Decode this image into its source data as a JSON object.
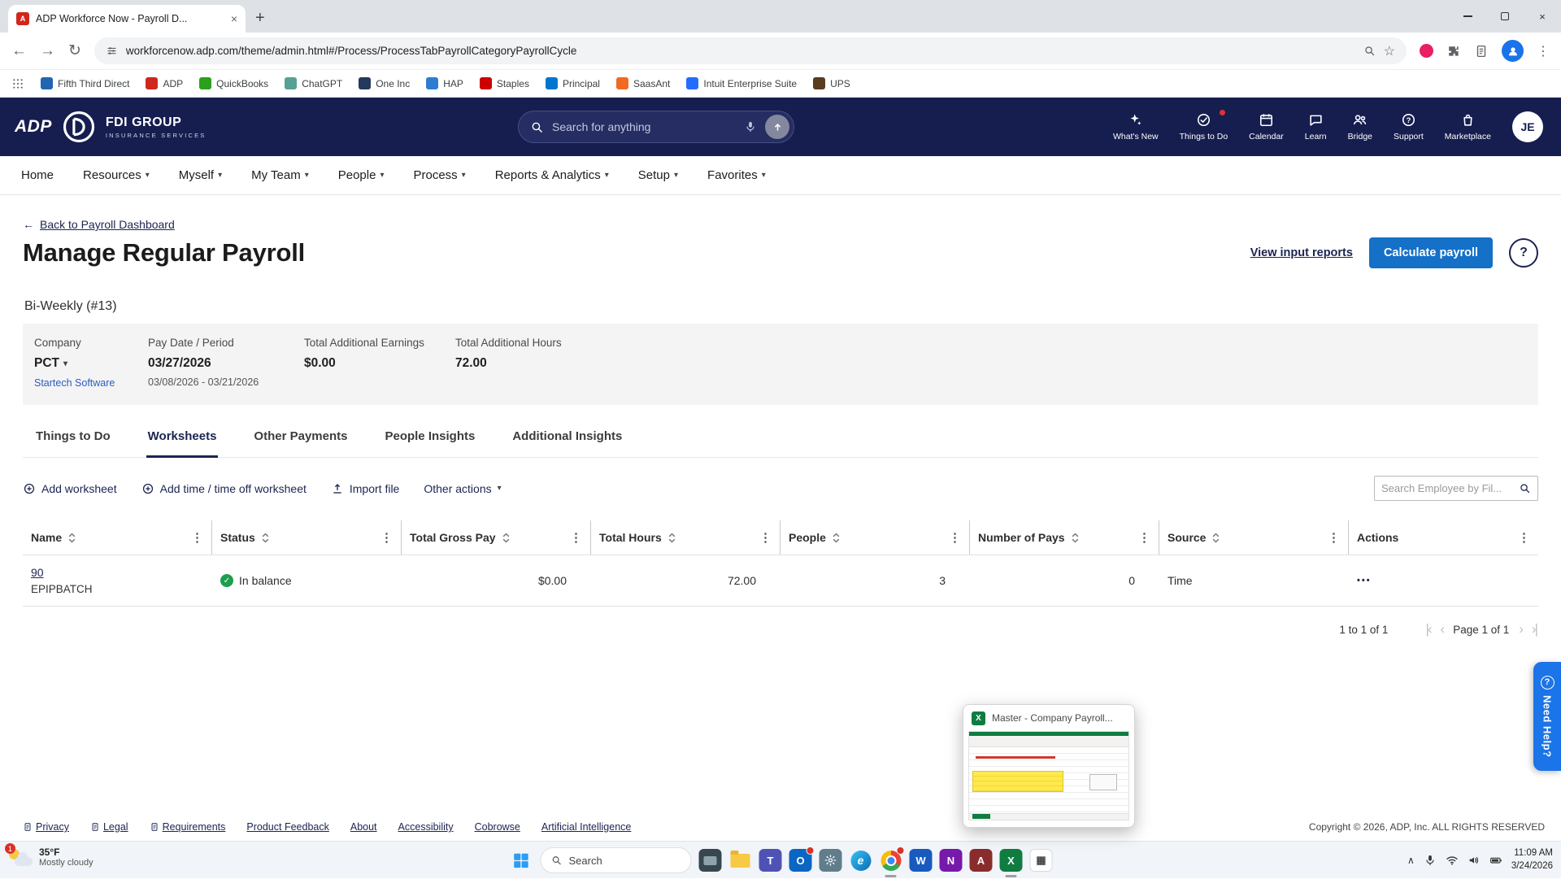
{
  "browser": {
    "tab_title": "ADP Workforce Now - Payroll D...",
    "favicon_letter": "A",
    "url": "workforcenow.adp.com/theme/admin.html#/Process/ProcessTabPayrollCategoryPayrollCycle",
    "bookmarks": [
      {
        "label": "Fifth Third Direct",
        "color": "#2166b0"
      },
      {
        "label": "ADP",
        "color": "#d0271d"
      },
      {
        "label": "QuickBooks",
        "color": "#2ca01c"
      },
      {
        "label": "ChatGPT",
        "color": "#57a094"
      },
      {
        "label": "One Inc",
        "color": "#23395d"
      },
      {
        "label": "HAP",
        "color": "#2e7dd1"
      },
      {
        "label": "Staples",
        "color": "#cc0000"
      },
      {
        "label": "Principal",
        "color": "#0076cf"
      },
      {
        "label": "SaasAnt",
        "color": "#f06a21"
      },
      {
        "label": "Intuit Enterprise Suite",
        "color": "#236cff"
      },
      {
        "label": "UPS",
        "color": "#5a3c1e"
      }
    ]
  },
  "header": {
    "adp_logo": "ADP",
    "brand_top": "FDI GROUP",
    "brand_bottom": "INSURANCE SERVICES",
    "search_placeholder": "Search for anything",
    "links": [
      "What's New",
      "Things to Do",
      "Calendar",
      "Learn",
      "Bridge",
      "Support",
      "Marketplace"
    ],
    "avatar": "JE"
  },
  "nav": [
    "Home",
    "Resources",
    "Myself",
    "My Team",
    "People",
    "Process",
    "Reports & Analytics",
    "Setup",
    "Favorites"
  ],
  "page": {
    "back": "Back to Payroll Dashboard",
    "title": "Manage Regular Payroll",
    "view_reports": "View input reports",
    "calculate": "Calculate payroll",
    "help": "?",
    "cycle": "Bi-Weekly (#13)",
    "summary": {
      "company_label": "Company",
      "company": "PCT",
      "company_link": "Startech Software",
      "paydate_label": "Pay Date / Period",
      "paydate": "03/27/2026",
      "period": "03/08/2026 - 03/21/2026",
      "earnings_label": "Total Additional Earnings",
      "earnings": "$0.00",
      "hours_label": "Total Additional Hours",
      "hours": "72.00"
    },
    "tabs": [
      "Things to Do",
      "Worksheets",
      "Other Payments",
      "People Insights",
      "Additional Insights"
    ],
    "active_tab": "Worksheets",
    "actions": {
      "add_worksheet": "Add worksheet",
      "add_time": "Add time / time off worksheet",
      "import_file": "Import file",
      "other_actions": "Other actions",
      "search_placeholder": "Search Employee by Fil..."
    },
    "table": {
      "columns": [
        "Name",
        "Status",
        "Total Gross Pay",
        "Total Hours",
        "People",
        "Number of Pays",
        "Source",
        "Actions"
      ],
      "row": {
        "name": "90",
        "name_sub": "EPIPBATCH",
        "status": "In balance",
        "gross": "$0.00",
        "hours": "72.00",
        "people": "3",
        "pays": "0",
        "source": "Time"
      }
    },
    "pagination": {
      "range": "1 to 1 of 1",
      "page": "Page 1 of 1"
    }
  },
  "footer": {
    "links": [
      "Privacy",
      "Legal",
      "Requirements",
      "Product Feedback",
      "About",
      "Accessibility",
      "Cobrowse",
      "Artificial Intelligence"
    ],
    "copyright": "Copyright © 2026, ADP, Inc. ALL RIGHTS RESERVED"
  },
  "popup": {
    "title": "Master - Company Payroll..."
  },
  "help_tab": "Need Help?",
  "taskbar": {
    "weather_temp": "35°F",
    "weather_cond": "Mostly cloudy",
    "weather_badge": "1",
    "search": "Search",
    "time": "11:09 AM",
    "date": "3/24/2026"
  }
}
